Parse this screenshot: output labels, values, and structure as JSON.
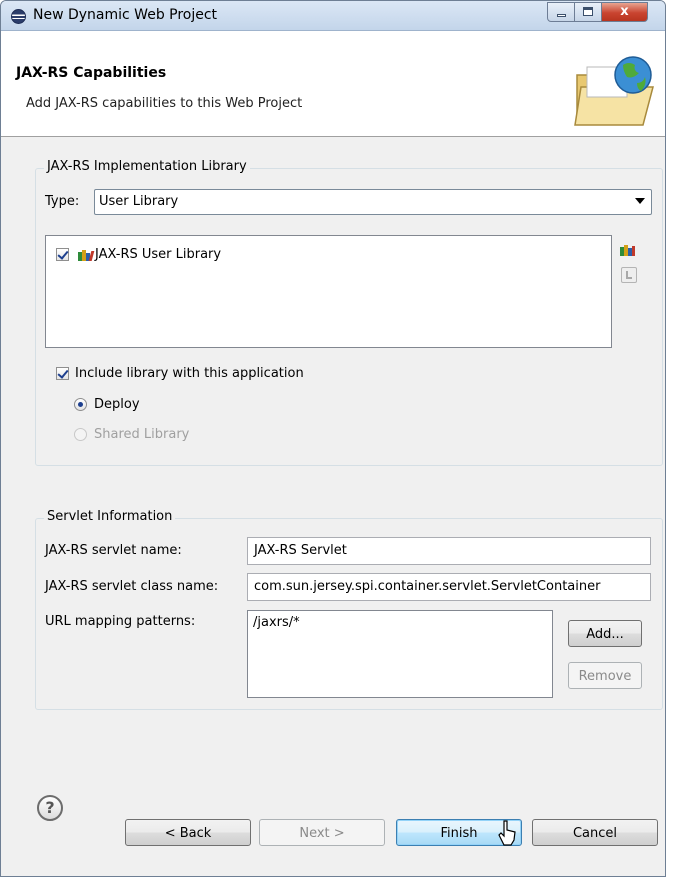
{
  "window": {
    "title": "New Dynamic Web Project",
    "close_glyph": "x"
  },
  "header": {
    "title": "JAX-RS Capabilities",
    "description": "Add JAX-RS capabilities to this Web Project",
    "icon": "folder-globe-icon"
  },
  "implementation": {
    "group_title": "JAX-RS Implementation Library",
    "type_label": "Type:",
    "type_value": "User Library",
    "libraries": [
      {
        "label": "JAX-RS User Library",
        "checked": true
      }
    ],
    "include_label": "Include library with this application",
    "include_checked": true,
    "deploy_label": "Deploy",
    "deploy_selected": true,
    "shared_label": "Shared Library",
    "shared_enabled": false,
    "side_icons": [
      "manage-libraries-icon",
      "download-library-icon"
    ]
  },
  "servlet": {
    "group_title": "Servlet Information",
    "name_label": "JAX-RS servlet name:",
    "name_value": "JAX-RS Servlet",
    "class_label": "JAX-RS servlet class name:",
    "class_value": "com.sun.jersey.spi.container.servlet.ServletContainer",
    "mapping_label": "URL mapping patterns:",
    "mappings": [
      "/jaxrs/*"
    ],
    "add_label": "Add...",
    "remove_label": "Remove"
  },
  "buttons": {
    "help_glyph": "?",
    "back_label": "< Back",
    "next_label": "Next >",
    "finish_label": "Finish",
    "cancel_label": "Cancel"
  },
  "colors": {
    "titlebar": "#c3d5ea",
    "dialog_bg": "#f0f0f0",
    "default_button": "#3c7fb1",
    "checkmark": "#1d3f8e"
  }
}
